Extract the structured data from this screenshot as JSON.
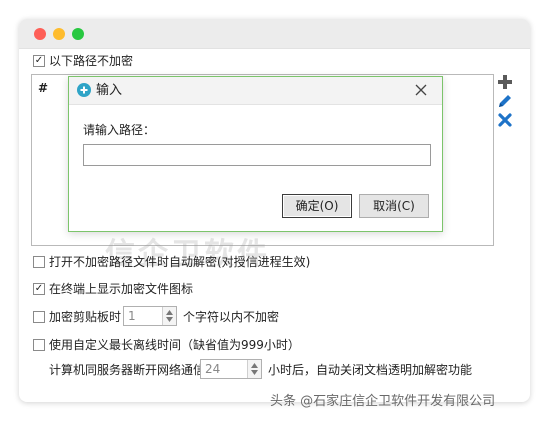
{
  "main": {
    "top_checkbox_label": "以下路径不加密",
    "top_checkbox_checked": true,
    "list_column_header": "#",
    "watermark_text": "信企卫软件"
  },
  "dialog": {
    "title": "输入",
    "prompt": "请输入路径：",
    "input_value": "",
    "ok_label": "确定(O)",
    "cancel_label": "取消(C)"
  },
  "options": {
    "auto_decrypt_label": "打开不加密路径文件时自动解密(对授信进程生效)",
    "auto_decrypt_checked": false,
    "show_icon_label": "在终端上显示加密文件图标",
    "show_icon_checked": true,
    "clipboard_label": "加密剪贴板时",
    "clipboard_checked": false,
    "clipboard_value": "1",
    "clipboard_suffix": "个字符以内不加密",
    "offline_label": "使用自定义最长离线时间（缺省值为999小时）",
    "offline_checked": false,
    "offline_prefix": "计算机同服务器断开网络通信",
    "offline_value": "24",
    "offline_suffix": "小时后，自动关闭文档透明加解密功能"
  },
  "footer": {
    "watermark": "头条 @石家庄信企卫软件开发有限公司"
  },
  "colors": {
    "add_icon": "#5a5a5a",
    "edit_icon": "#1e73c8",
    "delete_icon": "#1e73c8",
    "dialog_border": "#7cc46b",
    "dialog_icon": "#2fa4c7"
  },
  "icons": {
    "add": "plus-icon",
    "edit": "pencil-icon",
    "delete": "x-icon",
    "dialog": "input-dialog-icon",
    "close": "close-icon"
  }
}
